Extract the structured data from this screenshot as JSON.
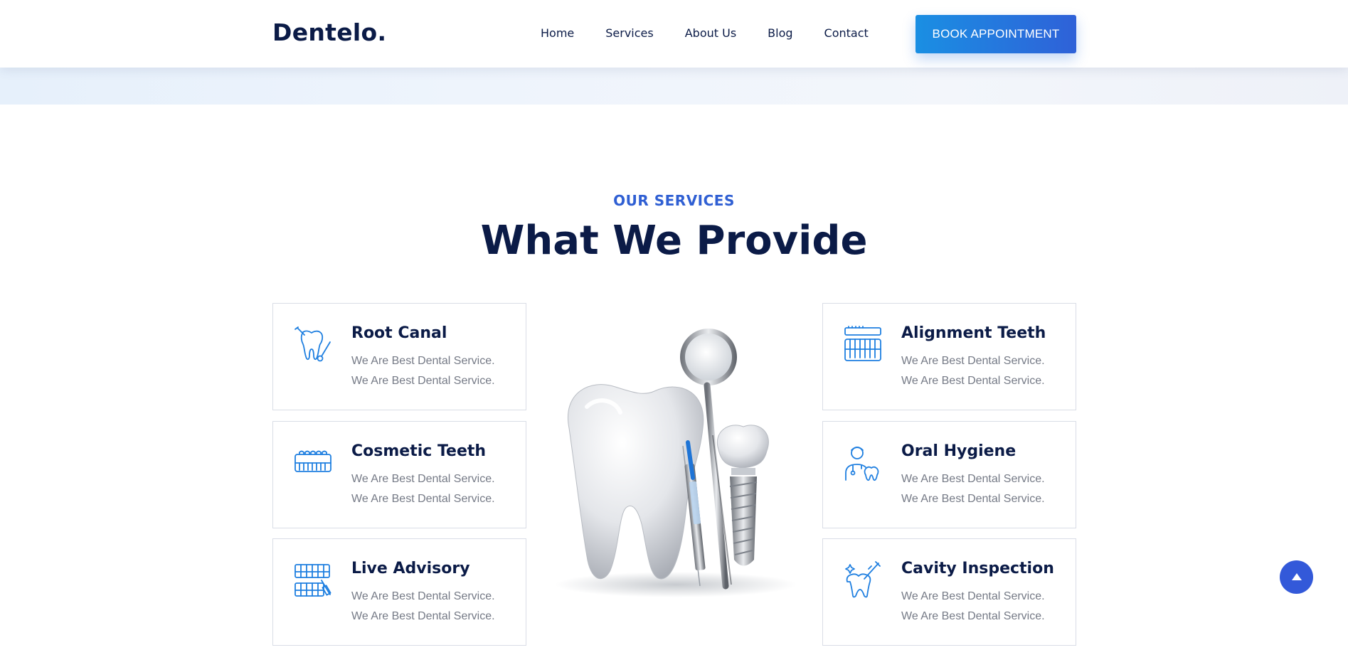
{
  "header": {
    "logo": "Dentelo.",
    "nav": [
      "Home",
      "Services",
      "About Us",
      "Blog",
      "Contact"
    ],
    "cta_label": "BOOK APPOINTMENT"
  },
  "services_section": {
    "label": "OUR SERVICES",
    "title": "What We Provide",
    "cards": [
      {
        "title": "Root Canal",
        "icon": "tooth-drill-icon",
        "lines": [
          "We Are Best Dental Service.",
          "We Are Best Dental Service."
        ]
      },
      {
        "title": "Cosmetic Teeth",
        "icon": "teeth-row-icon",
        "lines": [
          "We Are Best Dental Service.",
          "We Are Best Dental Service."
        ]
      },
      {
        "title": "Live Advisory",
        "icon": "teeth-brace-icon",
        "lines": [
          "We Are Best Dental Service.",
          "We Are Best Dental Service."
        ]
      },
      {
        "title": "Alignment Teeth",
        "icon": "brush-teeth-icon",
        "lines": [
          "We Are Best Dental Service.",
          "We Are Best Dental Service."
        ]
      },
      {
        "title": "Oral Hygiene",
        "icon": "dentist-icon",
        "lines": [
          "We Are Best Dental Service.",
          "We Are Best Dental Service."
        ]
      },
      {
        "title": "Cavity Inspection",
        "icon": "tooth-inspection-icon",
        "lines": [
          "We Are Best Dental Service.",
          "We Are Best Dental Service."
        ]
      }
    ]
  },
  "colors": {
    "accent": "#2f5fd3",
    "dark": "#0b1b47",
    "icon_blue": "#1f7fe0",
    "text_gray": "#757a86"
  }
}
